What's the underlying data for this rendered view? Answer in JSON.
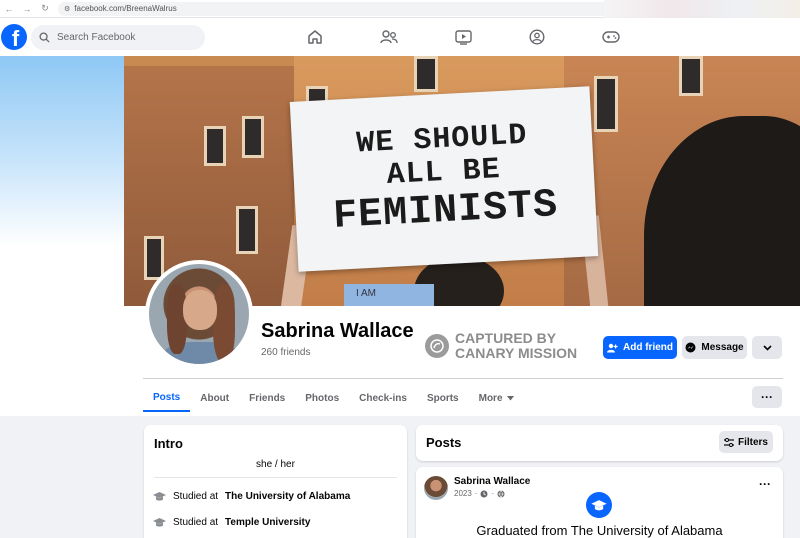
{
  "browser": {
    "url": "facebook.com/BreenaWalrus"
  },
  "header": {
    "logo": "f",
    "search_placeholder": "Search Facebook",
    "nav_icons": [
      "home-icon",
      "friends-icon",
      "watch-icon",
      "groups-icon",
      "gaming-icon"
    ]
  },
  "cover": {
    "sign_lines": [
      "WE SHOULD",
      "ALL BE",
      "FEMINISTS"
    ],
    "sign2_text": "I AM"
  },
  "profile": {
    "name": "Sabrina Wallace",
    "friends": "260 friends",
    "overlay_line1": "CAPTURED BY",
    "overlay_line2": "CANARY MISSION",
    "add_friend": "Add friend",
    "message": "Message"
  },
  "tabs": [
    "Posts",
    "About",
    "Friends",
    "Photos",
    "Check-ins",
    "Sports",
    "More"
  ],
  "intro": {
    "title": "Intro",
    "pronouns": "she / her",
    "education": [
      {
        "prefix": "Studied at",
        "school": "The University of Alabama"
      },
      {
        "prefix": "Studied at",
        "school": "Temple University"
      }
    ]
  },
  "posts": {
    "title": "Posts",
    "filters": "Filters",
    "post": {
      "author": "Sabrina Wallace",
      "year": "2023",
      "text": "Graduated from The University of Alabama"
    }
  },
  "colors": {
    "accent": "#0866ff",
    "background": "#f0f2f5"
  }
}
